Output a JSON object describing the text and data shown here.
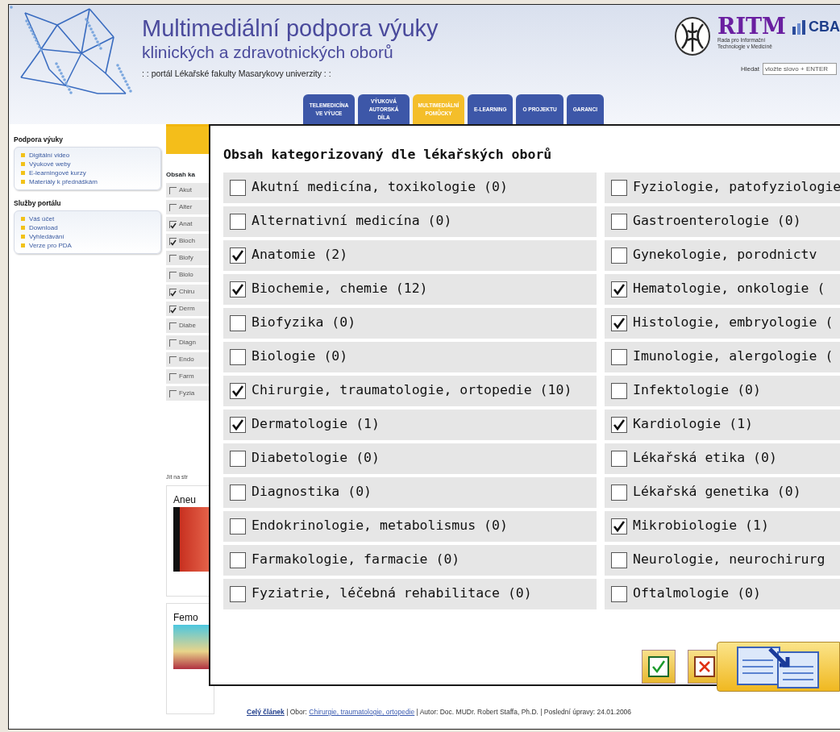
{
  "header": {
    "title_line1": "Multimediální podpora výuky",
    "title_line2": "klinických a zdravotnických oborů",
    "subtitle": ": : portál Lékařské fakulty Masarykovy univerzity : :",
    "logo_text": "RITM",
    "logo_caption": [
      "Rada pro Informační",
      "Technologie v Medicíně"
    ],
    "partner_logo_text": "CBA",
    "search": {
      "label": "Hledat",
      "value": "vložte slovo + ENTER"
    }
  },
  "tabs": [
    {
      "label": "TELEMEDICÍNA VE VÝUCE",
      "selected": false
    },
    {
      "label": "VÝUKOVÁ AUTORSKÁ DÍLA",
      "selected": false
    },
    {
      "label": "MULTIMEDIÁLNÍ POMŮCKY",
      "selected": true
    },
    {
      "label": "E-LEARNING",
      "selected": false
    },
    {
      "label": "O PROJEKTU",
      "selected": false
    },
    {
      "label": "GARANCI",
      "selected": false
    }
  ],
  "sidebar": [
    {
      "title": "Podpora výuky",
      "items": [
        "Digitální video",
        "Výukové weby",
        "E-learningové kurzy",
        "Materiály k přednáškám"
      ]
    },
    {
      "title": "Služby portálu",
      "items": [
        "Váš účet",
        "Download",
        "Vyhledávání",
        "Verze pro PDA"
      ]
    }
  ],
  "content": {
    "heading": "Obsah ka",
    "categories": [
      {
        "label": "Akut",
        "checked": false
      },
      {
        "label": "Alter",
        "checked": false
      },
      {
        "label": "Anat",
        "checked": true
      },
      {
        "label": "Bioch",
        "checked": true
      },
      {
        "label": "Biofy",
        "checked": false
      },
      {
        "label": "Biolo",
        "checked": false
      },
      {
        "label": "Chiru",
        "checked": true
      },
      {
        "label": "Derm",
        "checked": true
      },
      {
        "label": "Diabe",
        "checked": false
      },
      {
        "label": "Diagn",
        "checked": false
      },
      {
        "label": "Endo",
        "checked": false
      },
      {
        "label": "Farm",
        "checked": false
      },
      {
        "label": "Fyzia",
        "checked": false
      }
    ],
    "goto_label": "Jít na str",
    "articles": [
      {
        "title": "Aneu"
      },
      {
        "title": "Femo"
      }
    ],
    "footer": [
      {
        "text": "Celý článek",
        "link": true
      },
      {
        "text": " | Obor: ",
        "link": false
      },
      {
        "text": "Chirurgie, traumatologie, ortopedie",
        "link": true
      },
      {
        "text": " | Autor: Doc. MUDr. Robert Staffa, Ph.D. | Poslední úpravy: 24.01.2006",
        "link": false
      }
    ]
  },
  "dialog": {
    "title": "Obsah kategorizovaný dle lékařských oborů",
    "columns": [
      [
        {
          "label": "Akutní medicína, toxikologie (0)",
          "checked": false
        },
        {
          "label": "Alternativní medicína (0)",
          "checked": false
        },
        {
          "label": "Anatomie (2)",
          "checked": true
        },
        {
          "label": "Biochemie, chemie (12)",
          "checked": true
        },
        {
          "label": "Biofyzika (0)",
          "checked": false
        },
        {
          "label": "Biologie (0)",
          "checked": false
        },
        {
          "label": "Chirurgie, traumatologie, ortopedie (10)",
          "checked": true
        },
        {
          "label": "Dermatologie (1)",
          "checked": true
        },
        {
          "label": "Diabetologie (0)",
          "checked": false
        },
        {
          "label": "Diagnostika (0)",
          "checked": false
        },
        {
          "label": "Endokrinologie, metabolismus (0)",
          "checked": false
        },
        {
          "label": "Farmakologie, farmacie (0)",
          "checked": false
        },
        {
          "label": "Fyziatrie, léčebná rehabilitace (0)",
          "checked": false
        }
      ],
      [
        {
          "label": "Fyziologie, patofyziologie",
          "checked": false
        },
        {
          "label": "Gastroenterologie (0)",
          "checked": false
        },
        {
          "label": "Gynekologie, porodnictv",
          "checked": false
        },
        {
          "label": "Hematologie, onkologie (",
          "checked": true
        },
        {
          "label": "Histologie, embryologie (",
          "checked": true
        },
        {
          "label": "Imunologie, alergologie (",
          "checked": false
        },
        {
          "label": "Infektologie (0)",
          "checked": false
        },
        {
          "label": "Kardiologie (1)",
          "checked": true
        },
        {
          "label": "Lékařská etika (0)",
          "checked": false
        },
        {
          "label": "Lékařská genetika (0)",
          "checked": false
        },
        {
          "label": "Mikrobiologie (1)",
          "checked": true
        },
        {
          "label": "Neurologie, neurochirurg",
          "checked": false
        },
        {
          "label": "Oftalmologie (0)",
          "checked": false
        }
      ]
    ]
  }
}
